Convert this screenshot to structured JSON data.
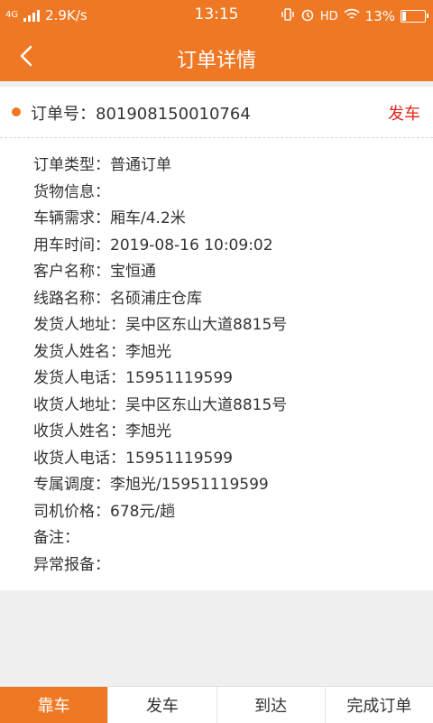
{
  "status_bar": {
    "network": "4G",
    "speed": "2.9K/s",
    "time": "13:15",
    "hd": "HD",
    "battery": "13%"
  },
  "nav": {
    "title": "订单详情"
  },
  "order": {
    "number_label": "订单号：801908150010764",
    "status": "发车",
    "details": [
      "订单类型：普通订单",
      "货物信息：",
      "车辆需求：厢车/4.2米",
      "用车时间：2019-08-16 10:09:02",
      "客户名称：宝恒通",
      "线路名称：名硕浦庄仓库",
      "发货人地址：吴中区东山大道8815号",
      "发货人姓名：李旭光",
      "发货人电话：15951119599",
      "收货人地址：吴中区东山大道8815号",
      "收货人姓名：李旭光",
      "收货人电话：15951119599",
      "专属调度：李旭光/15951119599",
      "司机价格：678元/趟",
      "备注：",
      "异常报备："
    ]
  },
  "tabs": [
    "靠车",
    "发车",
    "到达",
    "完成订单"
  ],
  "colors": {
    "primary": "#ee7824",
    "status_red": "#e2231a"
  }
}
